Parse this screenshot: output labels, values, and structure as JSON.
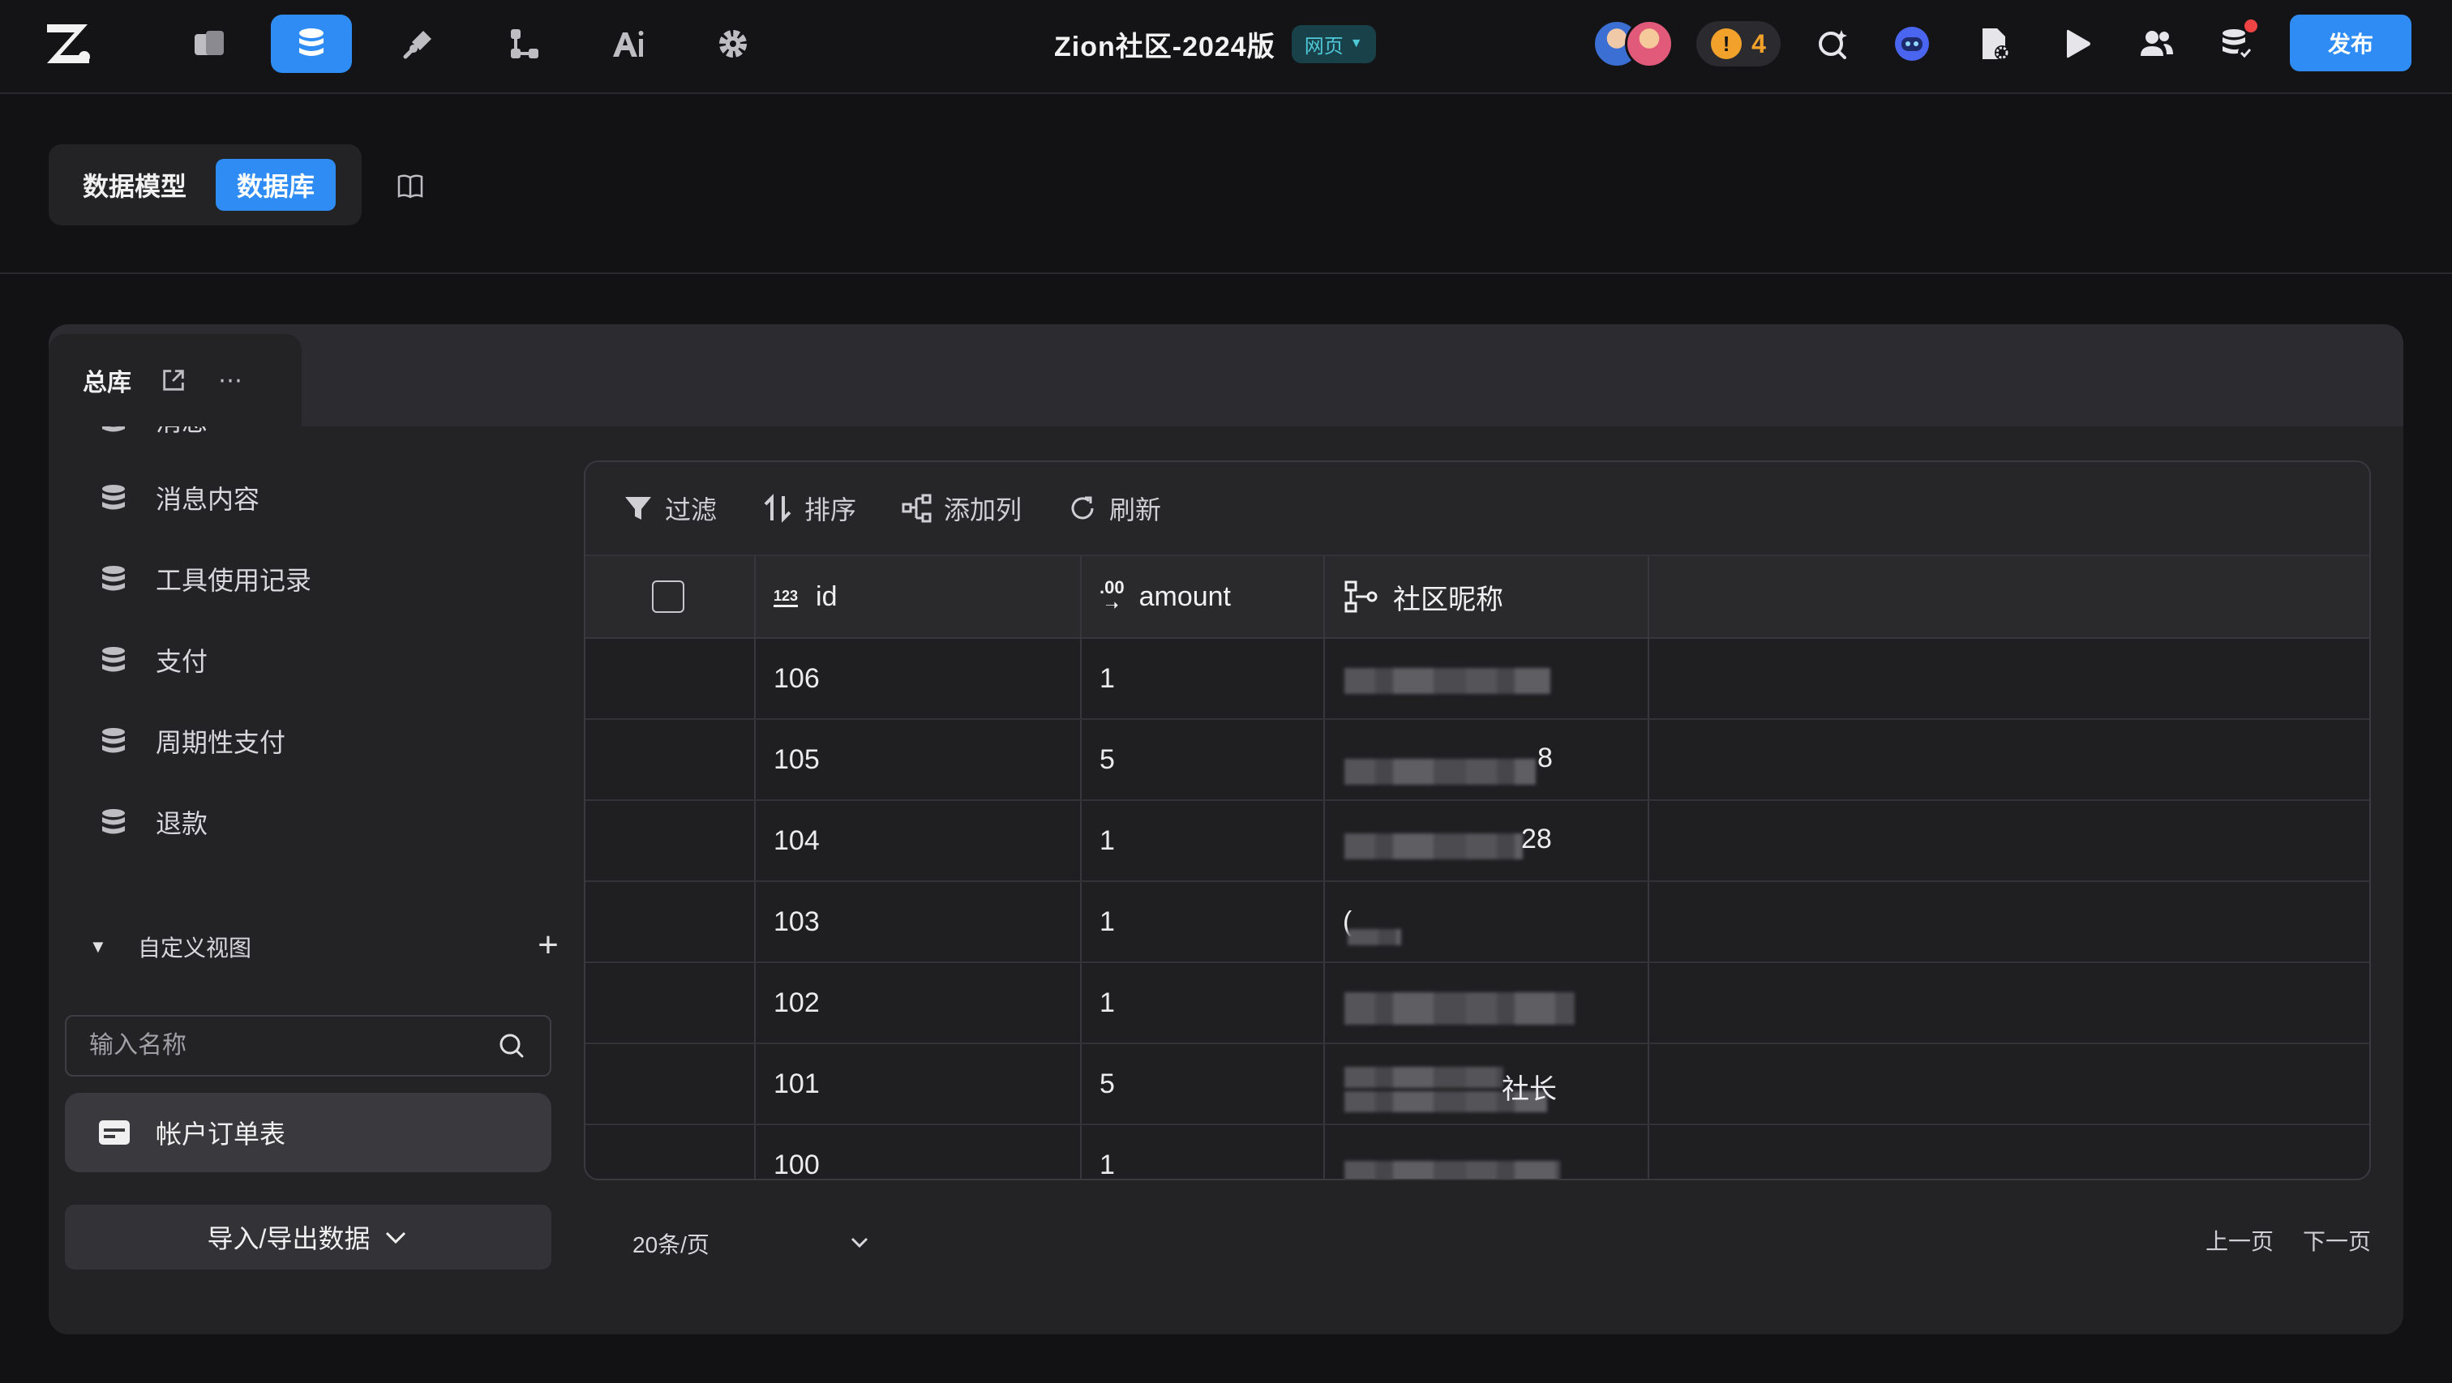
{
  "header": {
    "app_title": "Zion社区-2024版",
    "platform": "网页",
    "warning_count": "4",
    "publish_label": "发布"
  },
  "subnav": {
    "data_model": "数据模型",
    "database": "数据库"
  },
  "tab": {
    "label": "总库"
  },
  "sidebar": {
    "tables": [
      {
        "label": "消息"
      },
      {
        "label": "消息内容"
      },
      {
        "label": "工具使用记录"
      },
      {
        "label": "支付"
      },
      {
        "label": "周期性支付"
      },
      {
        "label": "退款"
      }
    ],
    "views_title": "自定义视图",
    "search_placeholder": "输入名称",
    "selected_view": "帐户订单表",
    "io_label": "导入/导出数据"
  },
  "toolbar": {
    "filter": "过滤",
    "sort": "排序",
    "add_column": "添加列",
    "refresh": "刷新"
  },
  "table": {
    "columns": [
      {
        "icon_text": "123",
        "label": "id"
      },
      {
        "icon_text": ".00",
        "label": "amount"
      },
      {
        "label": "社区昵称"
      }
    ],
    "rows": [
      {
        "id": "106",
        "amount": "1",
        "nickname": ""
      },
      {
        "id": "105",
        "amount": "5",
        "nickname": "8"
      },
      {
        "id": "104",
        "amount": "1",
        "nickname": "28"
      },
      {
        "id": "103",
        "amount": "1",
        "nickname": "("
      },
      {
        "id": "102",
        "amount": "1",
        "nickname": ""
      },
      {
        "id": "101",
        "amount": "5",
        "nickname": "社长"
      },
      {
        "id": "100",
        "amount": "1",
        "nickname": ""
      }
    ]
  },
  "pager": {
    "page_size": "20条/页",
    "prev": "上一页",
    "next": "下一页"
  },
  "colors": {
    "accent": "#2f8cf5",
    "warning": "#f2a22a",
    "badge_text": "#4fc9d8"
  }
}
